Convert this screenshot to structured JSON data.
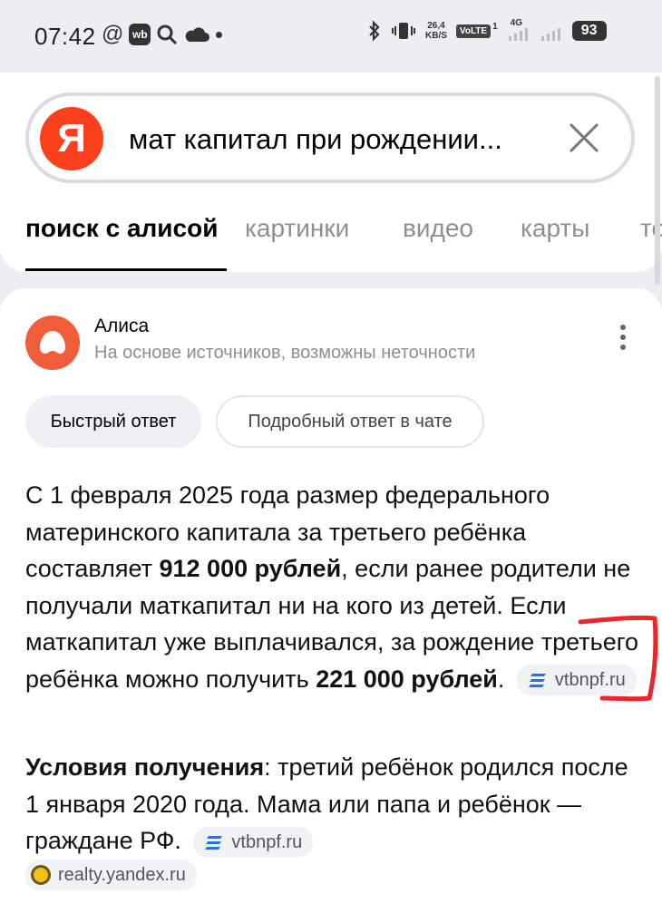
{
  "status_bar": {
    "time": "07:42",
    "wb_badge": "wb",
    "net_speed_value": "26,4",
    "net_speed_unit": "KB/S",
    "volte": "VoLTE",
    "sim1": "1",
    "net_type": "4G",
    "battery": "93"
  },
  "search": {
    "logo": "Я",
    "query": "мат капитал при рождении..."
  },
  "tabs": [
    {
      "label": "поиск с алисой",
      "active": true
    },
    {
      "label": "картинки",
      "active": false
    },
    {
      "label": "видео",
      "active": false
    },
    {
      "label": "карты",
      "active": false
    },
    {
      "label": "то",
      "active": false
    }
  ],
  "alice": {
    "name": "Алиса",
    "subtitle": "На основе источников, возможны неточности",
    "chip_quick": "Быстрый ответ",
    "chip_detailed": "Подробный ответ в чате"
  },
  "answer": {
    "p1_a": "С 1 февраля 2025 года размер федерального материнского капитала за третьего ребёнка составляет ",
    "p1_b": "912 000 рублей",
    "p1_c": ", если ранее родители не получали маткапитал ни на кого из детей. Если маткапитал уже выплачивался, за рождение третьего ребёнка можно получить ",
    "p1_d": "221 000 рублей",
    "p1_e": ".",
    "source_1": "vtbnpf.ru",
    "p2_a": "Условия получения",
    "p2_b": ": третий ребёнок родился после 1 января 2020 года. Мама или папа и ребёнок — граждане РФ.",
    "source_2": "vtbnpf.ru",
    "source_3": "realty.yandex.ru"
  },
  "colors": {
    "yandex_red": "#fc3f1d",
    "alice_orange": "#f15c3b",
    "markup_red": "#e8262b",
    "source_blue": "#2f6fd6"
  }
}
